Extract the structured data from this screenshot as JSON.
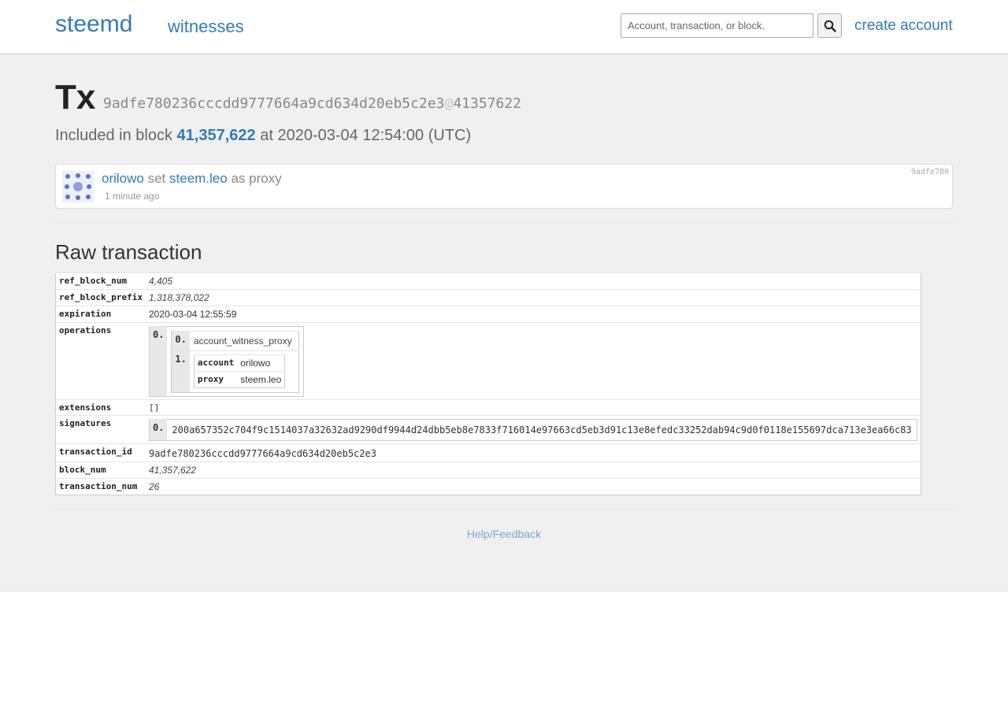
{
  "nav": {
    "brand": "steemd",
    "witnesses": "witnesses",
    "search_placeholder": "Account, transaction, or block.",
    "create_account": "create account"
  },
  "tx": {
    "title": "Tx",
    "hash": "9adfe780236cccdd9777664a9cd634d20eb5c2e3",
    "at": "@",
    "block_ref": "41357622",
    "included_prefix": "Included in block",
    "block_num_display": "41,357,622",
    "included_suffix": "at 2020-03-04 12:54:00 (UTC)"
  },
  "operation": {
    "account": "orilowo",
    "verb": "set",
    "proxy": "steem.leo",
    "suffix": "as proxy",
    "time_ago": "1 minute ago",
    "short_id": "9adfe780"
  },
  "raw": {
    "heading": "Raw transaction",
    "rows": {
      "ref_block_num": {
        "key": "ref_block_num",
        "value": "4,405"
      },
      "ref_block_prefix": {
        "key": "ref_block_prefix",
        "value": "1,318,378,022"
      },
      "expiration": {
        "key": "expiration",
        "value": "2020-03-04 12:55:59"
      },
      "operations": {
        "key": "operations",
        "outer_index": "0.",
        "inner_index_0": "0.",
        "op_type": "account_witness_proxy",
        "inner_index_1": "1.",
        "account_key": "account",
        "account_value": "orilowo",
        "proxy_key": "proxy",
        "proxy_value": "steem.leo"
      },
      "extensions": {
        "key": "extensions",
        "value": "[]"
      },
      "signatures": {
        "key": "signatures",
        "index": "0.",
        "value": "200a657352c704f9c1514037a32632ad9290df9944d24dbb5eb8e7833f716014e97663cd5eb3d91c13e8efedc33252dab94c9d0f0118e155697dca713e3ea66c83"
      },
      "transaction_id": {
        "key": "transaction_id",
        "value": "9adfe780236cccdd9777664a9cd634d20eb5c2e3"
      },
      "block_num": {
        "key": "block_num",
        "value": "41,357,622"
      },
      "transaction_num": {
        "key": "transaction_num",
        "value": "26"
      }
    }
  },
  "footer": {
    "help": "Help/Feedback"
  },
  "colors": {
    "link": "#337ab7",
    "background": "#f0f0f0",
    "avatar": "#5b72c8"
  },
  "icons": {
    "search": "search-icon",
    "avatar": "avatar-identicon"
  }
}
